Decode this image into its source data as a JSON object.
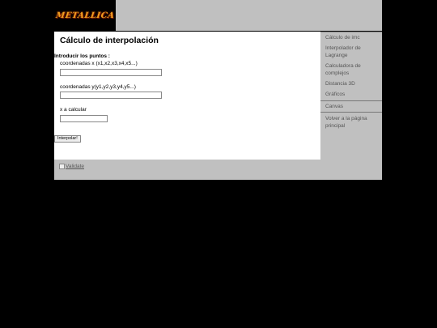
{
  "header": {
    "logo_text": "METALLICA"
  },
  "main": {
    "title": "Cálculo de interpolación",
    "form": {
      "heading": "Introducir los puntos :",
      "x_label": "coordenadas x (x1,x2,x3,x4,x5...)",
      "x_value": "",
      "y_label": "coordenadas y(y1,y2,y3,y4,y5...)",
      "y_value": "",
      "calc_label": "x a calcular",
      "calc_value": "",
      "submit_label": "Interpolar!"
    }
  },
  "sidebar": {
    "items": [
      {
        "label": "Cálculo de imc"
      },
      {
        "label": "Interpolador de Lagrange"
      },
      {
        "label": "Calculadora de complejos"
      },
      {
        "label": "Distancia 3D"
      },
      {
        "label": "Gráficos"
      },
      {
        "label": "Canvas"
      },
      {
        "label": "Volver a la página principal"
      }
    ]
  },
  "footer": {
    "validate_label": "Validate"
  }
}
